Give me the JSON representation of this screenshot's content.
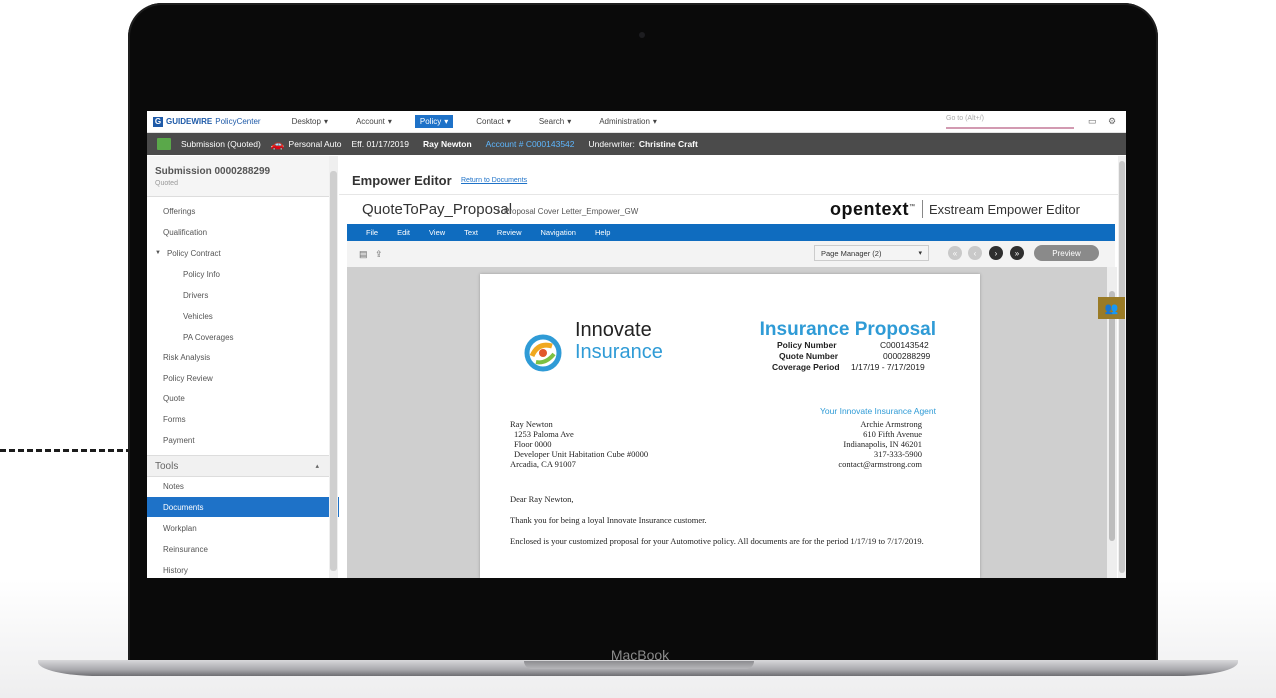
{
  "device": {
    "label": "MacBook"
  },
  "topbar": {
    "brand": "GUIDEWIRE",
    "product": "PolicyCenter",
    "nav": [
      "Desktop",
      "Account",
      "Policy",
      "Contact",
      "Search",
      "Administration"
    ],
    "active_nav": "Policy",
    "goto_placeholder": "Go to (Alt+/)"
  },
  "infobar": {
    "submission": "Submission (Quoted)",
    "product": "Personal Auto",
    "effective": "Eff. 01/17/2019",
    "insured": "Ray Newton",
    "account": "Account # C000143542",
    "underwriter_label": "Underwriter:",
    "underwriter": "Christine Craft"
  },
  "sidebar": {
    "title": "Submission 0000288299",
    "subtitle": "Quoted",
    "items": [
      "Offerings",
      "Qualification",
      "Policy Contract",
      "Policy Info",
      "Drivers",
      "Vehicles",
      "PA Coverages",
      "Risk Analysis",
      "Policy Review",
      "Quote",
      "Forms",
      "Payment"
    ],
    "tools_label": "Tools",
    "tools_items": [
      "Notes",
      "Documents",
      "Workplan",
      "Reinsurance",
      "History"
    ],
    "active_item": "Documents"
  },
  "editor": {
    "title": "Empower Editor",
    "return_link": "Return to Documents",
    "doc_name": "QuoteToPay_Proposal",
    "doc_separator": "/",
    "doc_sub": "Proposal Cover Letter_Empower_GW",
    "brand": "opentext",
    "brand_tm": "™",
    "product": "Exstream Empower Editor",
    "menu": [
      "File",
      "Edit",
      "View",
      "Text",
      "Review",
      "Navigation",
      "Help"
    ],
    "page_manager": "Page Manager (2)",
    "preview": "Preview"
  },
  "document": {
    "company_line1": "Innovate",
    "company_line2": "Insurance",
    "heading": "Insurance Proposal",
    "policy_number_label": "Policy Number",
    "policy_number": "C000143542",
    "quote_number_label": "Quote Number",
    "quote_number": "0000288299",
    "coverage_label": "Coverage Period",
    "coverage": "1/17/19 - 7/17/2019",
    "agent_heading": "Your Innovate Insurance Agent",
    "agent_lines": [
      "Archie Armstrong",
      "610 Fifth Avenue",
      "Indianapolis, IN 46201",
      "317-333-5900",
      "contact@armstrong.com"
    ],
    "address_lines": [
      "Ray Newton",
      "1253 Paloma Ave",
      "Floor 0000",
      "Developer Unit Habitation Cube #0000",
      "Arcadia, CA 91007"
    ],
    "salutation": "Dear Ray Newton,",
    "para1": "Thank you for being a loyal Innovate Insurance customer.",
    "para2": "Enclosed is your customized proposal for your Automotive policy. All documents are for the period 1/17/19 to 7/17/2019."
  },
  "colors": {
    "accent": "#1e72c8",
    "infobar": "#4b4b4b",
    "brand_blue": "#2f9bd6",
    "menubar": "#0f6cbf"
  }
}
